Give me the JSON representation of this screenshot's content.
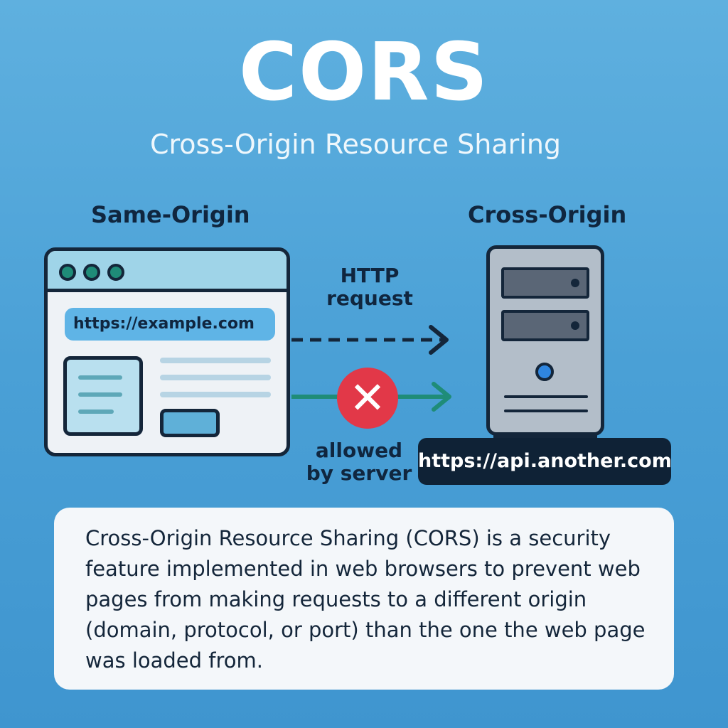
{
  "header": {
    "title": "CORS",
    "subtitle": "Cross-Origin Resource Sharing"
  },
  "same_origin": {
    "label": "Same-Origin",
    "url": "https://example.com"
  },
  "cross_origin": {
    "label": "Cross-Origin",
    "url": "https://api.another.com"
  },
  "arrows": {
    "request_label": "HTTP\nrequest",
    "allowed_label": "allowed\nby server",
    "blocked_icon": "x-icon"
  },
  "description": {
    "text": "Cross-Origin Resource Sharing (CORS) is a security\nfeature implemented in web browsers to prevent web\npages from making requests to a different origin\n(domain, protocol, or port) than the one the web page\nwas loaded from."
  },
  "colors": {
    "background": "#4aa0d6",
    "ink": "#14263a",
    "blocked": "#e23848",
    "allowed_arrow": "#1f8c78"
  }
}
